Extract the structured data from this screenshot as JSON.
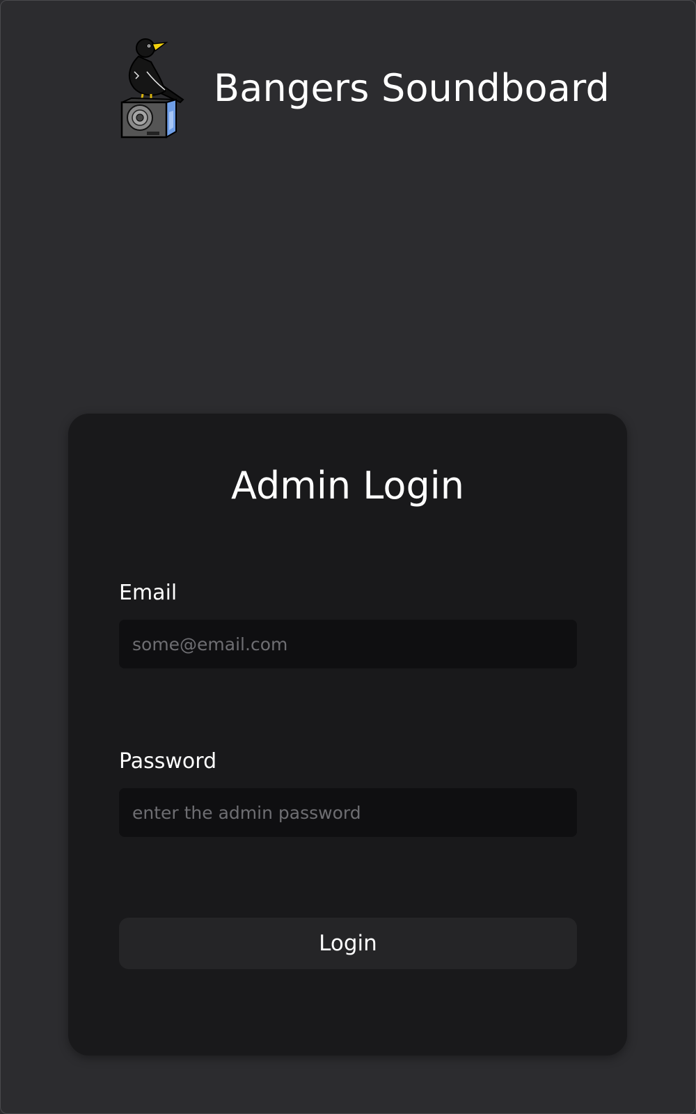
{
  "header": {
    "title": "Bangers Soundboard",
    "logo_icon": "crow-on-speaker-icon"
  },
  "login_card": {
    "title": "Admin Login",
    "email": {
      "label": "Email",
      "placeholder": "some@email.com",
      "value": ""
    },
    "password": {
      "label": "Password",
      "placeholder": "enter the admin password",
      "value": ""
    },
    "submit_label": "Login"
  },
  "colors": {
    "page_background": "#2c2c2f",
    "card_background": "#19191b",
    "input_background": "#0f0f11",
    "button_background": "#252527",
    "text": "#ffffff",
    "placeholder": "#6e6e72"
  }
}
